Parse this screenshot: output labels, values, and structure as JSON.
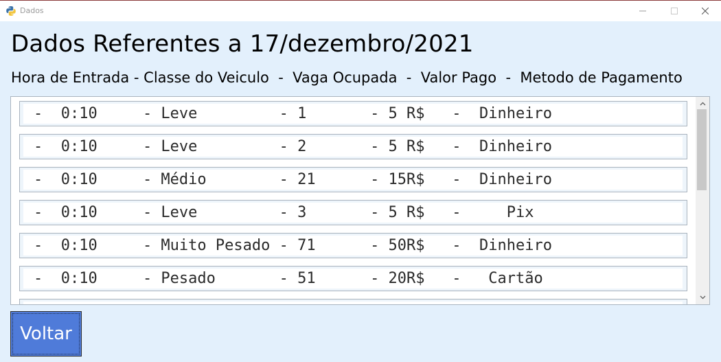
{
  "window": {
    "title": "Dados"
  },
  "heading": "Dados Referentes a 17/dezembro/2021",
  "columns_header": "Hora de Entrada - Classe do Veiculo  -  Vaga Ocupada  -  Valor Pago  -  Metodo de Pagamento",
  "rows": [
    {
      "text": "-  0:10     - Leve         - 1       - 5 R$   -  Dinheiro"
    },
    {
      "text": "-  0:10     - Leve         - 2       - 5 R$   -  Dinheiro"
    },
    {
      "text": "-  0:10     - Médio        - 21      - 15R$   -  Dinheiro"
    },
    {
      "text": "-  0:10     - Leve         - 3       - 5 R$   -     Pix"
    },
    {
      "text": "-  0:10     - Muito Pesado - 71      - 50R$   -  Dinheiro"
    },
    {
      "text": "-  0:10     - Pesado       - 51      - 20R$   -   Cartão"
    }
  ],
  "buttons": {
    "voltar": "Voltar"
  },
  "colors": {
    "background": "#e3f0fc",
    "button": "#4f7bd9"
  },
  "icons": {
    "app": "python-icon",
    "minimize": "minimize-icon",
    "maximize": "maximize-icon",
    "close": "close-icon",
    "scroll_up": "chevron-up-icon",
    "scroll_down": "chevron-down-icon"
  }
}
